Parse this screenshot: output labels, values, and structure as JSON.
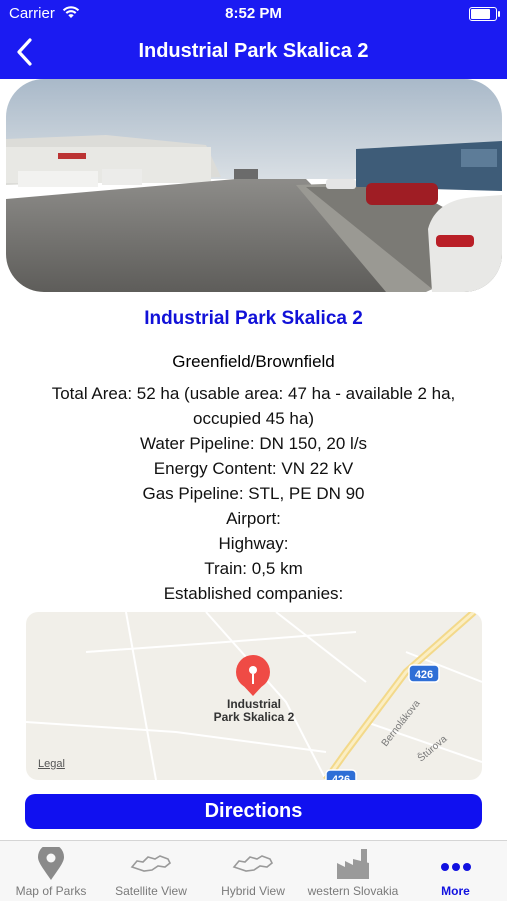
{
  "status_bar": {
    "carrier": "Carrier",
    "time": "8:52 PM"
  },
  "nav": {
    "title": "Industrial Park Skalica 2",
    "back_icon": "chevron-left-icon"
  },
  "park": {
    "name": "Industrial Park Skalica 2",
    "field_type": "Greenfield/Brownfield",
    "details": [
      "Total Area: 52 ha (usable area: 47 ha  - available 2 ha,",
      "occupied 45 ha)",
      "Water Pipeline: DN 150, 20 l/s",
      "Energy Content: VN 22 kV",
      "Gas Pipeline: STL, PE DN 90",
      "Airport:",
      "Highway:",
      "Train: 0,5 km",
      "Established companies:"
    ]
  },
  "map": {
    "pin_label_line1": "Industrial",
    "pin_label_line2": "Park Skalica 2",
    "legal": "Legal",
    "road_badge": "426",
    "road_badge_bottom": "426",
    "street_1": "Bernolákova",
    "street_2": "Štúrova"
  },
  "directions_label": "Directions",
  "tabs": [
    {
      "label": "Map of Parks",
      "icon": "map-pin-icon"
    },
    {
      "label": "Satellite View",
      "icon": "slovakia-outline-icon"
    },
    {
      "label": "Hybrid View",
      "icon": "slovakia-outline-icon"
    },
    {
      "label": "western Slovakia",
      "icon": "factory-icon"
    },
    {
      "label": "More",
      "icon": "more-dots-icon"
    }
  ],
  "colors": {
    "primary": "#1b1bf2",
    "title_text": "#1111d8",
    "active_tab": "#1111e0",
    "pin": "#ef4b45"
  }
}
